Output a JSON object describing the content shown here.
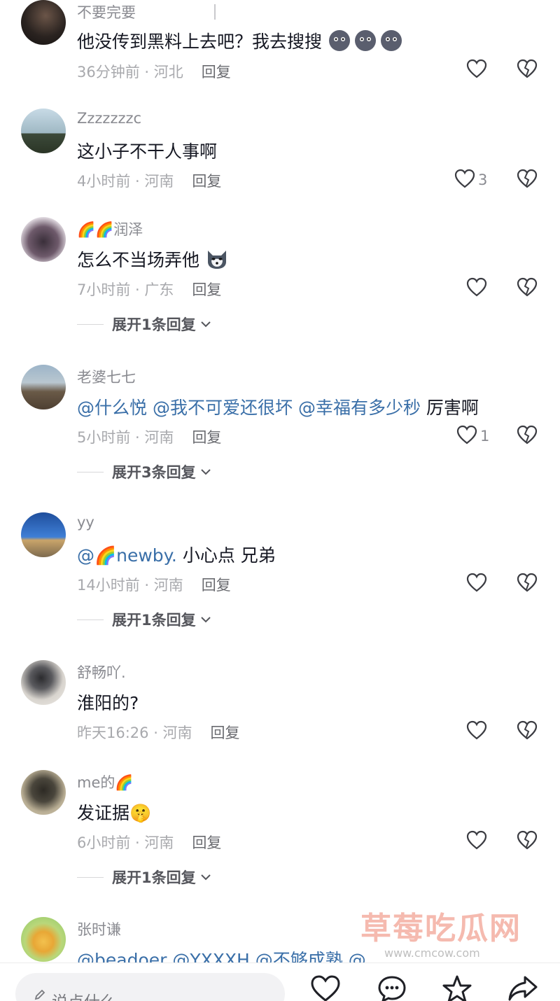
{
  "comments": [
    {
      "user": "不要完要",
      "text": "他没传到黑料上去吧？我去搜搜",
      "emoji_count": 3,
      "time": "36分钟前 · 河北",
      "reply": "回复",
      "likes": ""
    },
    {
      "user": "Zzzzzzzc",
      "text": "这小子不干人事啊",
      "time": "4小时前 · 河南",
      "reply": "回复",
      "likes": "3"
    },
    {
      "user": "润泽",
      "user_prefix": "🌈🌈",
      "text": "怎么不当场弄他",
      "time": "7小时前 · 广东",
      "reply": "回复",
      "likes": "",
      "expand": "展开1条回复"
    },
    {
      "user": "老婆七七",
      "mentions": [
        "@什么悦",
        "@我不可爱还很坏",
        "@幸福有多少秒"
      ],
      "text_after": "厉害啊",
      "time": "5小时前 · 河南",
      "reply": "回复",
      "likes": "1",
      "expand": "展开3条回复"
    },
    {
      "user": "yy",
      "mention": "@🌈newby.",
      "text_after": "小心点 兄弟",
      "time": "14小时前 · 河南",
      "reply": "回复",
      "likes": "",
      "expand": "展开1条回复"
    },
    {
      "user": "舒畅吖.",
      "text": "淮阳的?",
      "time": "昨天16:26 · 河南",
      "reply": "回复",
      "likes": ""
    },
    {
      "user": "me的🌈",
      "text": "发证据🤫",
      "time": "6小时前 · 河南",
      "reply": "回复",
      "likes": "",
      "expand": "展开1条回复"
    },
    {
      "user": "张时谦",
      "mentions": [
        "@beadoer",
        "@YXXXH",
        "@不够成熟",
        "@"
      ]
    }
  ],
  "watermark": {
    "line1": "草莓吃瓜网",
    "line2": "www.cmcow.com"
  },
  "bottom_bar": {
    "placeholder": "说点什么..."
  },
  "colors": {
    "mention": "#3a6fa8",
    "meta": "#a8a9ad",
    "username": "#8a8b91"
  }
}
